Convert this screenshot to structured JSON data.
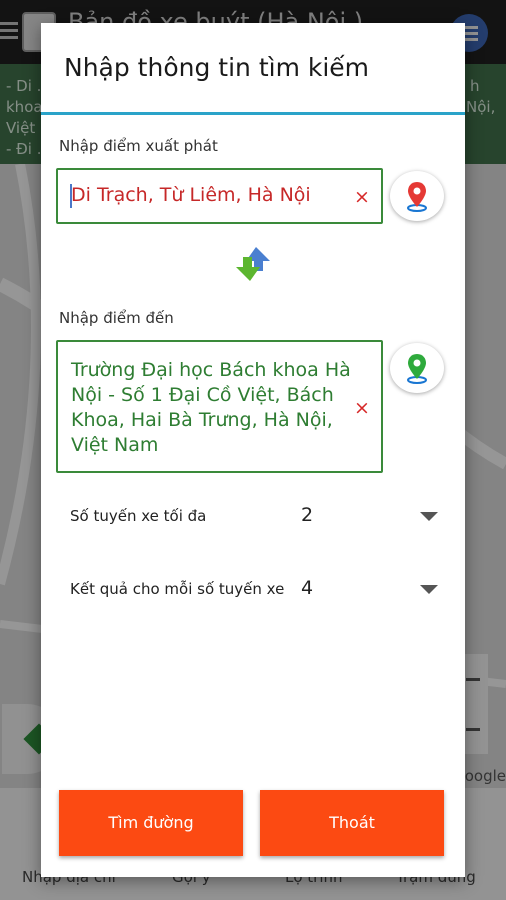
{
  "background": {
    "app_title": "Bản đồ xe buýt (Hà Nội )",
    "banner_lines": [
      "- Di ...",
      "khoa ...",
      "Việt ...",
      "- Đi ..."
    ],
    "banner_right": [
      "h",
      "Nội,"
    ],
    "map_attribution": "oogle",
    "bottom_nav": [
      "Nhập địa chỉ",
      "Gợi ý",
      "Lộ trình",
      "Trạm dừng"
    ]
  },
  "dialog": {
    "title": "Nhập thông tin tìm kiếm",
    "start": {
      "label": "Nhập điểm xuất phát",
      "value": "Di Trạch, Từ Liêm, Hà Nội",
      "clear": "×"
    },
    "destination": {
      "label": "Nhập điểm đến",
      "value_lines": [
        "Trường Đại học Bách khoa Hà",
        "Nội - Số 1 Đại Cồ Việt, Bách",
        "Khoa, Hai Bà Trưng, Hà Nội,",
        "Việt Nam"
      ],
      "clear": "×"
    },
    "max_routes": {
      "label": "Số tuyến xe tối đa",
      "value": "2"
    },
    "results_per_route": {
      "label": "Kết quả cho mỗi số tuyến xe",
      "value": "4"
    },
    "search_button": "Tìm đường",
    "exit_button": "Thoát"
  },
  "colors": {
    "accent": "#2aa3c9",
    "button": "#fc4a12",
    "start_text": "#c62828",
    "dest_text": "#2e7d32",
    "field_border": "#3a8a3a"
  },
  "icons": {
    "start_pin": "red-location-pin-icon",
    "dest_pin": "green-location-pin-icon",
    "swap": "swap-arrows-icon",
    "dropdown": "caret-down-icon"
  }
}
